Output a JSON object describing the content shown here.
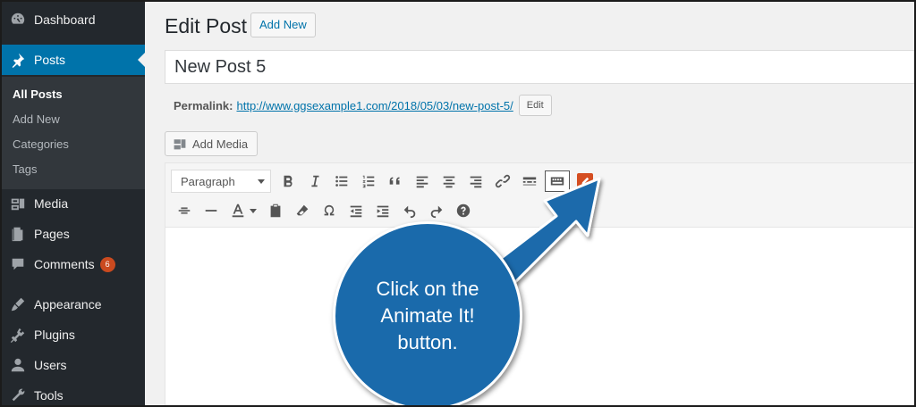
{
  "sidebar": {
    "items": [
      {
        "label": "Dashboard",
        "icon": "dashboard-icon"
      },
      {
        "label": "Posts",
        "icon": "pin-icon",
        "active": true
      },
      {
        "label": "Media",
        "icon": "media-icon"
      },
      {
        "label": "Pages",
        "icon": "pages-icon"
      },
      {
        "label": "Comments",
        "icon": "comments-icon",
        "badge": "6"
      },
      {
        "label": "Appearance",
        "icon": "appearance-icon"
      },
      {
        "label": "Plugins",
        "icon": "plugins-icon"
      },
      {
        "label": "Users",
        "icon": "users-icon"
      },
      {
        "label": "Tools",
        "icon": "tools-icon"
      }
    ],
    "submenu": [
      "All Posts",
      "Add New",
      "Categories",
      "Tags"
    ]
  },
  "header": {
    "title": "Edit Post",
    "add_new": "Add New"
  },
  "post": {
    "title": "New Post 5",
    "permalink_label": "Permalink:",
    "permalink_url": "http://www.ggsexample1.com/2018/05/03/new-post-5/",
    "permalink_edit": "Edit"
  },
  "editor": {
    "add_media": "Add Media",
    "format_select": "Paragraph"
  },
  "callout": {
    "text": "Click on the Animate It! button.",
    "color": "#1a6aab"
  },
  "colors": {
    "sidebar_bg": "#23282d",
    "active_bg": "#0073aa",
    "badge_bg": "#ca4a1f",
    "animate_button": "#d54e21"
  }
}
